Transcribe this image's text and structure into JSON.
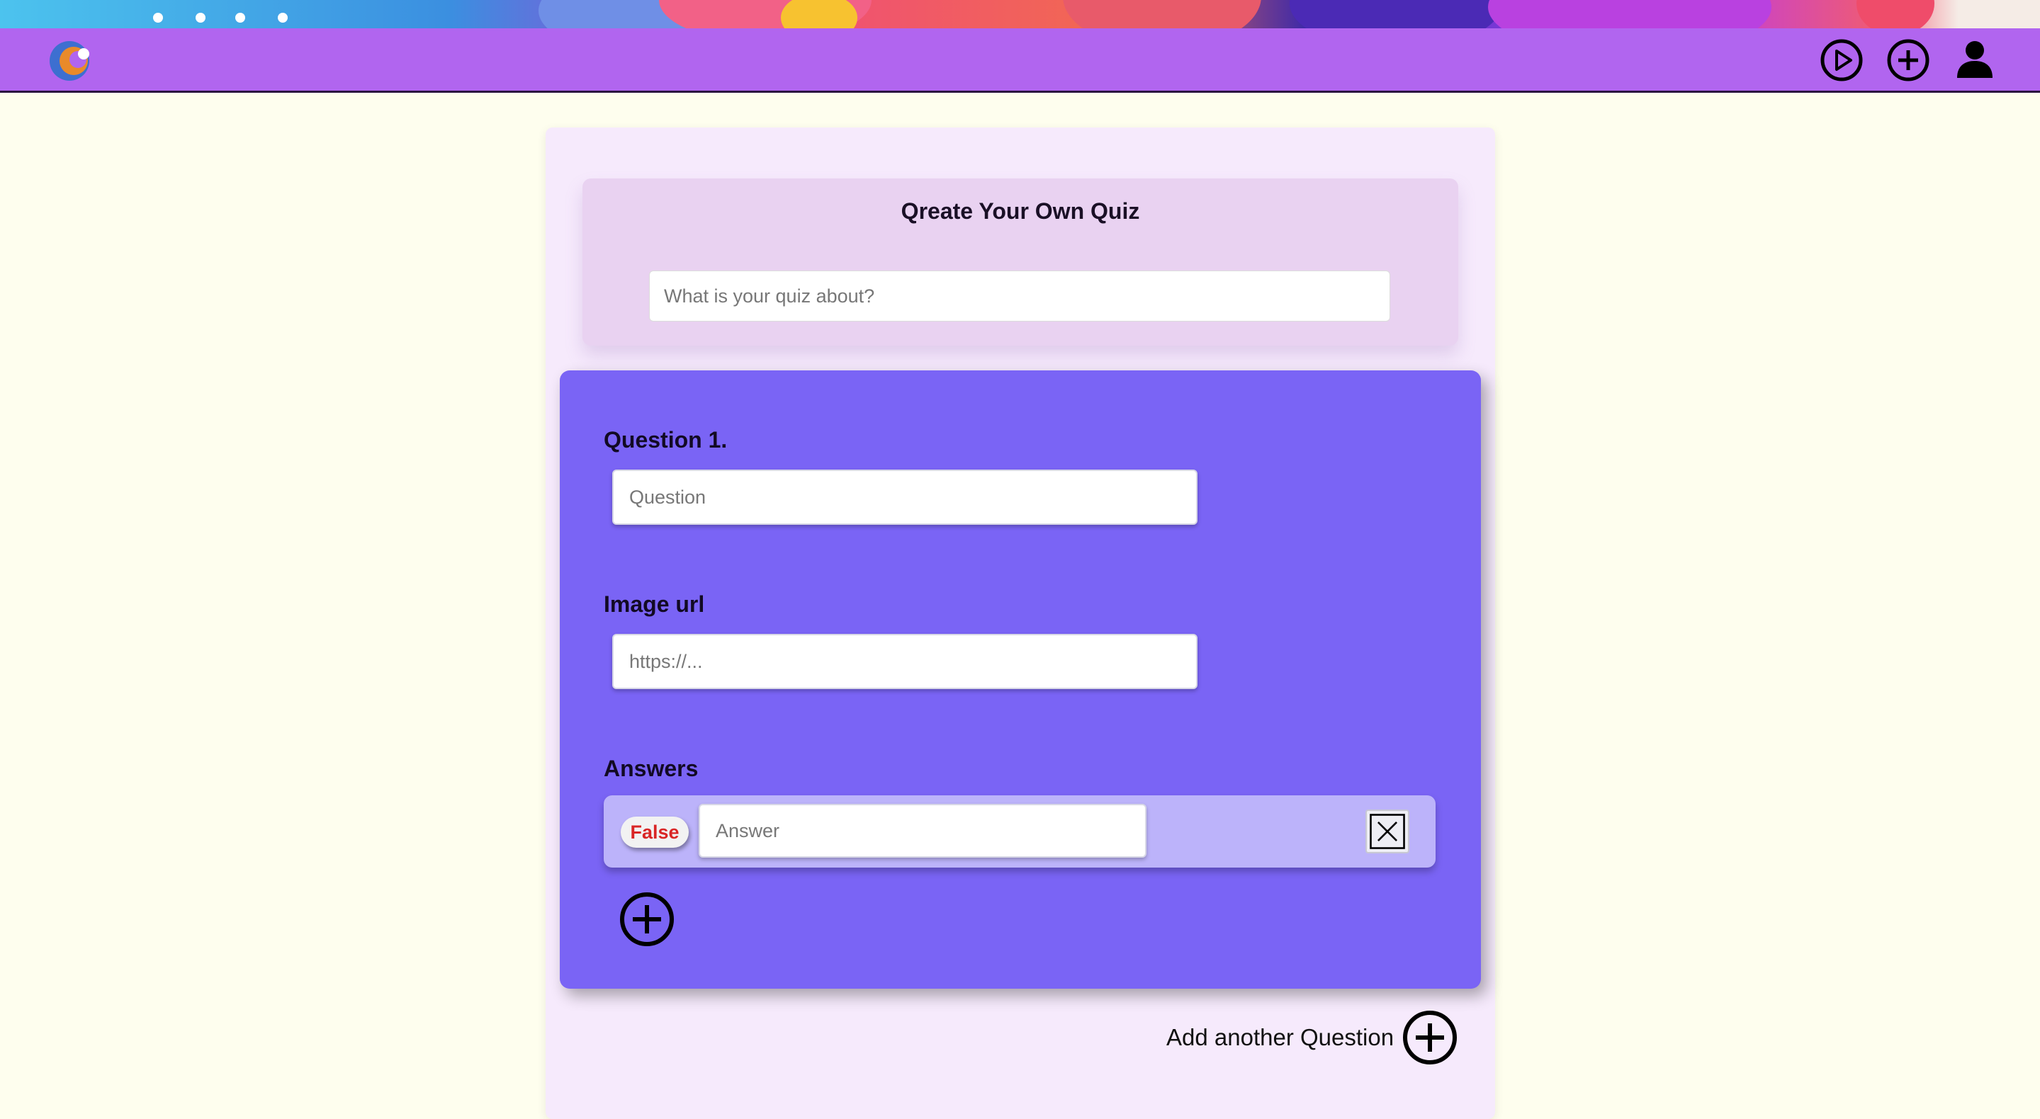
{
  "nav": {
    "icons": [
      "play-circle-icon",
      "plus-circle-icon",
      "user-icon"
    ]
  },
  "quiz": {
    "title": "Qreate Your Own Quiz",
    "topic_placeholder": "What is your quiz about?",
    "topic_value": ""
  },
  "question": {
    "label": "Question 1.",
    "question_placeholder": "Question",
    "image_label": "Image url",
    "image_placeholder": "https://...",
    "answers_label": "Answers",
    "answers": [
      {
        "status": "False",
        "placeholder": "Answer",
        "value": ""
      }
    ]
  },
  "footer": {
    "add_question_label": "Add another Question"
  },
  "colors": {
    "navbar": "#b165ef",
    "question_card": "#7a64f5",
    "answer_row": "#bcb3fa",
    "false_text": "#d92525",
    "page_background": "#fefeee"
  }
}
